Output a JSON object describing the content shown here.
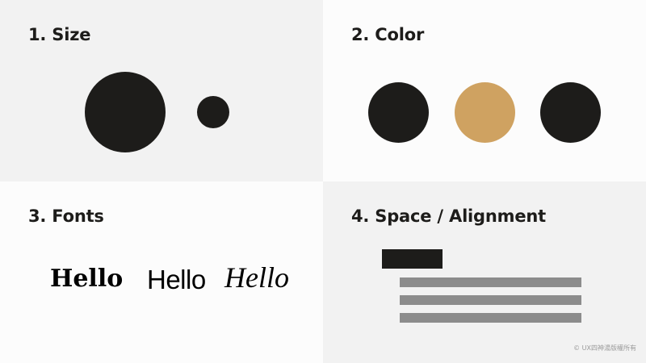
{
  "colors": {
    "dark": "#1d1c1a",
    "gold": "#cfa261",
    "gray_bar": "#8c8c8c",
    "panel_light": "#f2f2f2",
    "panel_white": "#fcfcfc"
  },
  "panels": {
    "size": {
      "title": "1. Size"
    },
    "color": {
      "title": "2. Color"
    },
    "fonts": {
      "title": "3. Fonts",
      "samples": [
        "Hello",
        "Hello",
        "Hello"
      ]
    },
    "space": {
      "title": "4. Space / Alignment"
    }
  },
  "footer": {
    "copyright": "© UX四神湯版權所有"
  }
}
